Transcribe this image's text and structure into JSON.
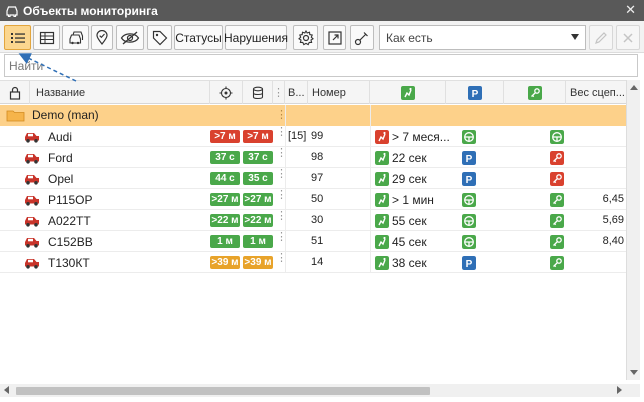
{
  "window": {
    "title": "Объекты мониторинга",
    "icon": "car-window-icon",
    "close_label": "✕"
  },
  "toolbar": {
    "list_view_icon": "list-icon",
    "table_view_icon": "table-icon",
    "vehicles_icon": "vehicles-icon",
    "geofence_icon": "location-pin-icon",
    "hide_icon": "eye-off-icon",
    "tag_icon": "tag-icon",
    "statuses_label": "Статусы",
    "violations_label": "Нарушения",
    "settings_icon": "gear-icon",
    "export_icon": "export-icon",
    "link_icon": "link-icon",
    "view_select": "Как есть",
    "edit_icon": "pencil-icon",
    "delete_icon": "close-icon"
  },
  "search": {
    "placeholder": "Найти"
  },
  "columns": {
    "lock_icon": "lock-icon",
    "name": "Название",
    "gps_icon": "crosshair-icon",
    "db_icon": "database-icon",
    "b": "В...",
    "number": "Номер",
    "motion_icon": "motion-icon",
    "parking_icon": "parking-icon",
    "ignition_icon": "key-icon",
    "weight": "Вес сцеп..."
  },
  "group": {
    "label": "Demo (man)"
  },
  "rows": [
    {
      "name": "Audi",
      "gps": ">7 м",
      "db": ">7 м",
      "gps_color": "#d9412e",
      "db_color": "#d9412e",
      "b": "[15]",
      "number": "99",
      "motion_text": "> 7 меся...",
      "motion_color": "#d9412e",
      "status_icon": "steering-icon",
      "ign_color": "#4aa84a",
      "ign_icon": "steering-icon",
      "weight": ""
    },
    {
      "name": "Ford",
      "gps": "37 с",
      "db": "37 с",
      "gps_color": "#4aa84a",
      "db_color": "#4aa84a",
      "b": "",
      "number": "98",
      "motion_text": "22 сек",
      "motion_color": "#4aa84a",
      "status_icon": "parking-icon",
      "ign_color": "#d9412e",
      "ign_icon": "key-icon",
      "weight": ""
    },
    {
      "name": "Opel",
      "gps": "44 с",
      "db": "35 с",
      "gps_color": "#4aa84a",
      "db_color": "#4aa84a",
      "b": "",
      "number": "97",
      "motion_text": "29 сек",
      "motion_color": "#4aa84a",
      "status_icon": "parking-icon",
      "ign_color": "#d9412e",
      "ign_icon": "key-icon",
      "weight": ""
    },
    {
      "name": "Р115ОР",
      "gps": ">27 м",
      "db": ">27 м",
      "gps_color": "#4aa84a",
      "db_color": "#4aa84a",
      "b": "",
      "number": "50",
      "motion_text": "> 1 мин",
      "motion_color": "#4aa84a",
      "status_icon": "steering-icon",
      "ign_color": "#4aa84a",
      "ign_icon": "key-icon",
      "weight": "6,45"
    },
    {
      "name": "А022ТТ",
      "gps": ">22 м",
      "db": ">22 м",
      "gps_color": "#4aa84a",
      "db_color": "#4aa84a",
      "b": "",
      "number": "30",
      "motion_text": "55 сек",
      "motion_color": "#4aa84a",
      "status_icon": "steering-icon",
      "ign_color": "#4aa84a",
      "ign_icon": "key-icon",
      "weight": "5,69"
    },
    {
      "name": "С152ВВ",
      "gps": "1 м",
      "db": "1 м",
      "gps_color": "#4aa84a",
      "db_color": "#4aa84a",
      "b": "",
      "number": "51",
      "motion_text": "45 сек",
      "motion_color": "#4aa84a",
      "status_icon": "steering-icon",
      "ign_color": "#4aa84a",
      "ign_icon": "key-icon",
      "weight": "8,40"
    },
    {
      "name": "Т130КТ",
      "gps": ">39 м",
      "db": ">39 м",
      "gps_color": "#e8a32a",
      "db_color": "#e8a32a",
      "b": "",
      "number": "14",
      "motion_text": "38 сек",
      "motion_color": "#4aa84a",
      "status_icon": "parking-icon",
      "ign_color": "#4aa84a",
      "ign_icon": "key-icon",
      "weight": ""
    }
  ],
  "colors": {
    "title_bg": "#595959",
    "group_bg": "#fdd18a",
    "active_btn": "#fbd68f",
    "parking_blue": "#2f6fb6",
    "green": "#4aa84a",
    "red": "#d9412e",
    "orange": "#e8a32a"
  }
}
